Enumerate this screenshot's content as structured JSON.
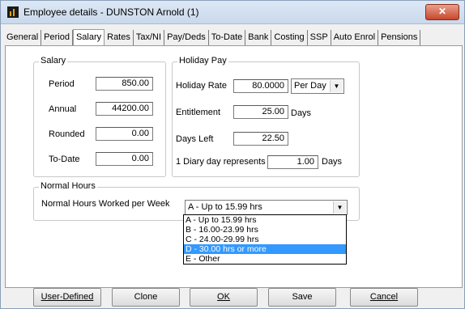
{
  "window": {
    "title": "Employee details - DUNSTON Arnold (1)",
    "close_glyph": "✕"
  },
  "tabs": [
    {
      "label": "General",
      "active": false
    },
    {
      "label": "Period",
      "active": false
    },
    {
      "label": "Salary",
      "active": true
    },
    {
      "label": "Rates",
      "active": false
    },
    {
      "label": "Tax/NI",
      "active": false
    },
    {
      "label": "Pay/Deds",
      "active": false
    },
    {
      "label": "To-Date",
      "active": false
    },
    {
      "label": "Bank",
      "active": false
    },
    {
      "label": "Costing",
      "active": false
    },
    {
      "label": "SSP",
      "active": false
    },
    {
      "label": "Auto Enrol",
      "active": false
    },
    {
      "label": "Pensions",
      "active": false
    }
  ],
  "salary": {
    "legend": "Salary",
    "period_label": "Period",
    "period_value": "850.00",
    "annual_label": "Annual",
    "annual_value": "44200.00",
    "rounded_label": "Rounded",
    "rounded_value": "0.00",
    "todate_label": "To-Date",
    "todate_value": "0.00"
  },
  "holiday": {
    "legend": "Holiday Pay",
    "rate_label": "Holiday Rate",
    "rate_value": "80.0000",
    "rate_unit": "Per Day",
    "entitlement_label": "Entitlement",
    "entitlement_value": "25.00",
    "entitlement_unit": "Days",
    "daysleft_label": "Days Left",
    "daysleft_value": "22.50",
    "diary_label": "1 Diary day represents",
    "diary_value": "1.00",
    "diary_unit": "Days"
  },
  "normal_hours": {
    "legend": "Normal Hours",
    "label": "Normal Hours Worked per Week",
    "selected": "A - Up to 15.99 hrs",
    "options": [
      {
        "label": "A - Up to 15.99 hrs",
        "highlighted": false
      },
      {
        "label": "B - 16.00-23.99 hrs",
        "highlighted": false
      },
      {
        "label": "C - 24.00-29.99 hrs",
        "highlighted": false
      },
      {
        "label": "D - 30.00 hrs or more",
        "highlighted": true
      },
      {
        "label": "E - Other",
        "highlighted": false
      }
    ]
  },
  "buttons": {
    "user_defined": "User-Defined",
    "clone": "Clone",
    "ok": "OK",
    "save": "Save",
    "cancel": "Cancel"
  }
}
